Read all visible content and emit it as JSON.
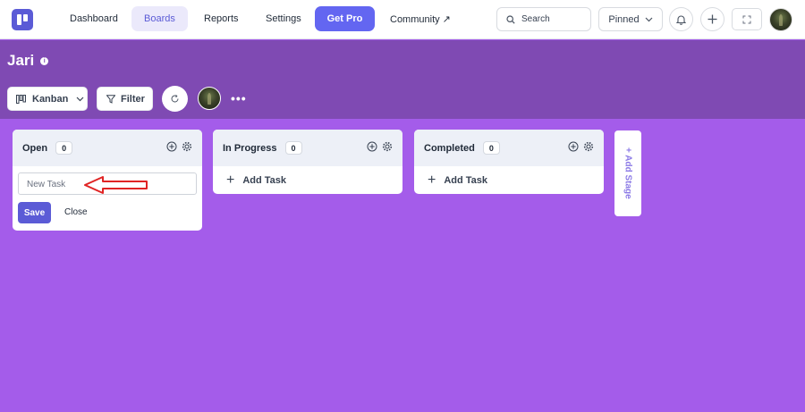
{
  "nav": {
    "items": [
      "Dashboard",
      "Boards",
      "Reports",
      "Settings"
    ],
    "get_pro": "Get Pro",
    "community": "Community ↗",
    "search_placeholder": "Search",
    "pinned": "Pinned"
  },
  "board": {
    "title": "Jari",
    "view_label": "Kanban",
    "filter_label": "Filter",
    "more": "•••"
  },
  "columns": [
    {
      "name": "Open",
      "count": "0"
    },
    {
      "name": "In Progress",
      "count": "0"
    },
    {
      "name": "Completed",
      "count": "0"
    }
  ],
  "add_task_label": "Add Task",
  "new_task": {
    "placeholder": "New Task",
    "save": "Save",
    "close": "Close"
  },
  "add_stage_label": "+ Add Stage",
  "colors": {
    "accent": "#5b5bd6",
    "board_header": "#7f4ab3",
    "board_background": "#a45cea",
    "annotation_arrow": "#e02424"
  }
}
